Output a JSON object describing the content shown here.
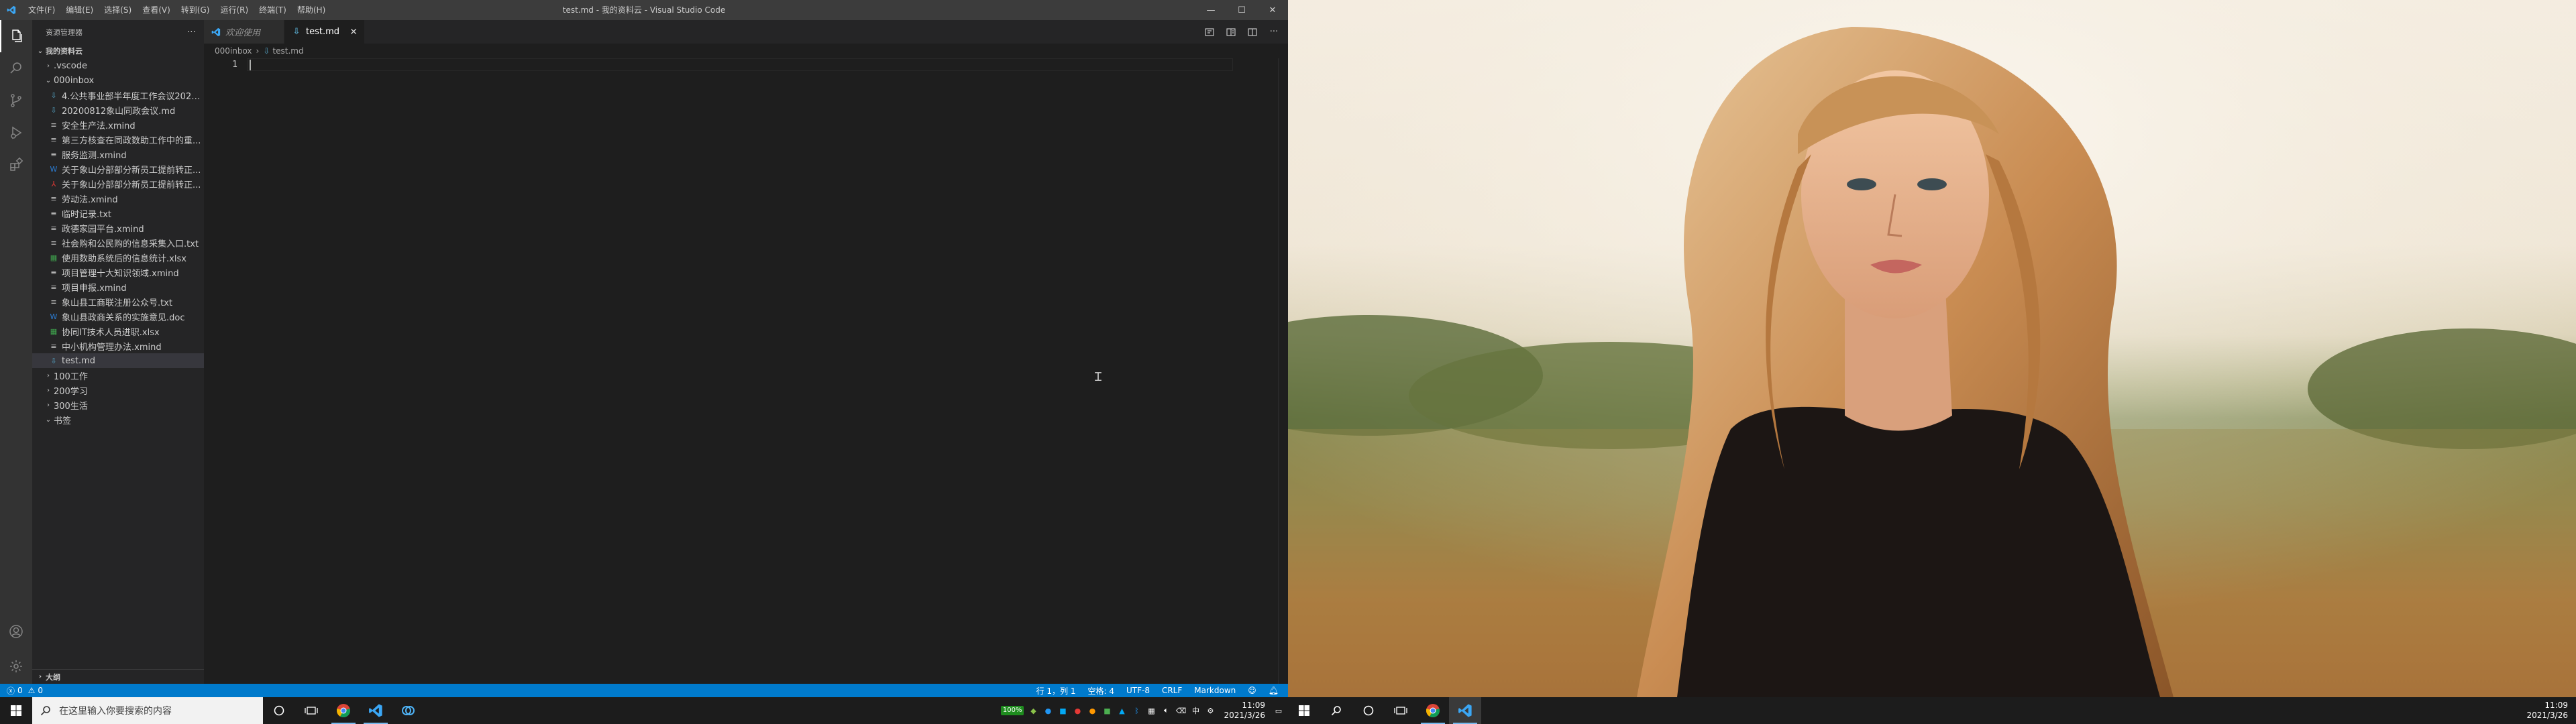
{
  "window": {
    "title": "test.md - 我的资料云 - Visual Studio Code",
    "menu": [
      "文件(F)",
      "编辑(E)",
      "选择(S)",
      "查看(V)",
      "转到(G)",
      "运行(R)",
      "终端(T)",
      "帮助(H)"
    ],
    "controls": {
      "minimize": "—",
      "maximize": "☐",
      "close": "✕"
    }
  },
  "activity_bar": [
    "files-icon",
    "search-icon",
    "source-control-icon",
    "run-debug-icon",
    "extensions-icon",
    "account-icon",
    "settings-gear-icon"
  ],
  "explorer": {
    "header": "资源管理器",
    "more": "···",
    "workspace": "我的资料云",
    "items": [
      {
        "label": ".vscode",
        "kind": "folder",
        "depth": 1,
        "open": false
      },
      {
        "label": "000inbox",
        "kind": "folder",
        "depth": 1,
        "open": true
      },
      {
        "label": "4.公共事业部半年度工作会议20200...",
        "kind": "md",
        "depth": 2
      },
      {
        "label": "20200812象山同政会议.md",
        "kind": "md",
        "depth": 2
      },
      {
        "label": "安全生产法.xmind",
        "kind": "xmind",
        "depth": 2
      },
      {
        "label": "第三方核查在同政数助工作中的重...",
        "kind": "xmind",
        "depth": 2
      },
      {
        "label": "服务监测.xmind",
        "kind": "xmind",
        "depth": 2
      },
      {
        "label": "关于象山分部部分新员工提前转正...",
        "kind": "word",
        "depth": 2
      },
      {
        "label": "关于象山分部部分新员工提前转正...",
        "kind": "pdf",
        "depth": 2
      },
      {
        "label": "劳动法.xmind",
        "kind": "xmind",
        "depth": 2
      },
      {
        "label": "临时记录.txt",
        "kind": "txt",
        "depth": 2
      },
      {
        "label": "政德家园平台.xmind",
        "kind": "xmind",
        "depth": 2
      },
      {
        "label": "社会购和公民购的信息采集入口.txt",
        "kind": "txt",
        "depth": 2
      },
      {
        "label": "使用数助系统后的信息统计.xlsx",
        "kind": "xlsx",
        "depth": 2
      },
      {
        "label": "项目管理十大知识领域.xmind",
        "kind": "xmind",
        "depth": 2
      },
      {
        "label": "项目申报.xmind",
        "kind": "xmind",
        "depth": 2
      },
      {
        "label": "象山县工商联注册公众号.txt",
        "kind": "txt",
        "depth": 2
      },
      {
        "label": "象山县政商关系的实施意见.doc",
        "kind": "word",
        "depth": 2
      },
      {
        "label": "协同IT技术人员进职.xlsx",
        "kind": "xlsx",
        "depth": 2
      },
      {
        "label": "中小机构管理办法.xmind",
        "kind": "xmind",
        "depth": 2
      },
      {
        "label": "test.md",
        "kind": "md",
        "depth": 2,
        "selected": true
      },
      {
        "label": "100工作",
        "kind": "folder",
        "depth": 1,
        "open": false
      },
      {
        "label": "200学习",
        "kind": "folder",
        "depth": 1,
        "open": false
      },
      {
        "label": "300生活",
        "kind": "folder",
        "depth": 1,
        "open": false
      },
      {
        "label": "书签",
        "kind": "folder",
        "depth": 1,
        "open": true
      }
    ],
    "outline": "大纲"
  },
  "tabs": [
    {
      "label": "欢迎使用",
      "active": false
    },
    {
      "label": "test.md",
      "active": true,
      "close": "✕"
    }
  ],
  "breadcrumb": [
    "000inbox",
    "test.md"
  ],
  "editor": {
    "line_number": "1"
  },
  "status_bar": {
    "errors": "0",
    "warnings": "0",
    "position": "行 1，列 1",
    "indent": "空格: 4",
    "encoding": "UTF-8",
    "eol": "CRLF",
    "language": "Markdown"
  },
  "taskbar_left": {
    "search_placeholder": "在这里输入你要搜索的内容",
    "battery": "100%",
    "time": "11:09",
    "date": "2021/3/26"
  },
  "taskbar_right": {
    "time": "11:09",
    "date": "2021/3/26"
  },
  "colors": {
    "accent": "#007acc",
    "title_bar": "#3c3c3c",
    "sidebar": "#252526",
    "editor_bg": "#1e1e1e",
    "taskbar": "#1c1c1c"
  }
}
